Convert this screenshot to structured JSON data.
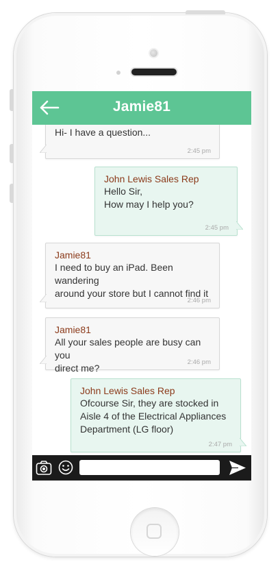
{
  "header": {
    "title": "Jamie81",
    "back_icon": "back-arrow-icon",
    "color": "#5dc594"
  },
  "messages": [
    {
      "direction": "in",
      "sender": "",
      "lines": [
        "Hi- I have a question..."
      ],
      "time": "2:45 pm"
    },
    {
      "direction": "out",
      "sender": "John Lewis Sales Rep",
      "lines": [
        "Hello Sir,",
        "How may I help you?"
      ],
      "time": "2:45 pm"
    },
    {
      "direction": "in",
      "sender": "Jamie81",
      "lines": [
        "I need to buy an iPad. Been wandering",
        "around your store but I cannot find it"
      ],
      "time": "2:46 pm"
    },
    {
      "direction": "in",
      "sender": "Jamie81",
      "lines": [
        "All your sales people are busy can you",
        "direct me?"
      ],
      "time": "2:46 pm"
    },
    {
      "direction": "out",
      "sender": "John Lewis Sales Rep",
      "lines": [
        "Ofcourse Sir, they are stocked in",
        "Aisle 4 of the Electrical Appliances",
        "Department (LG floor)"
      ],
      "time": "2:47 pm"
    }
  ],
  "composer": {
    "input_value": "",
    "camera_icon": "camera-icon",
    "emoji_icon": "smiley-icon",
    "send_icon": "send-icon"
  },
  "colors": {
    "incoming_bubble": "#f7f7f7",
    "outgoing_bubble": "#e8f6f0",
    "sender_name": "#8b3a1a"
  }
}
